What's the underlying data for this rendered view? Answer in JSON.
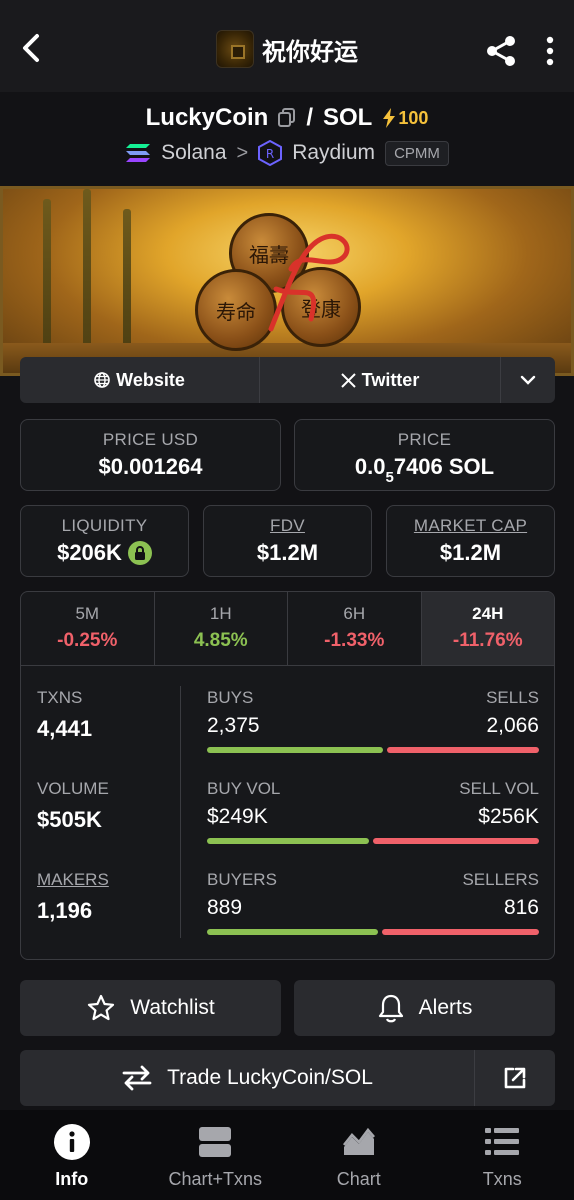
{
  "header": {
    "title": "祝你好运"
  },
  "pair": {
    "base": "LuckyCoin",
    "slash": "/",
    "quote": "SOL",
    "boost": "100",
    "chain": "Solana",
    "chevron": ">",
    "dex": "Raydium",
    "pool_type": "CPMM"
  },
  "links": {
    "website": "Website",
    "twitter": "Twitter"
  },
  "prices": {
    "price_usd_label": "PRICE USD",
    "price_usd": "$0.001264",
    "price_label": "PRICE",
    "price_prefix": "0.0",
    "price_zeros": "5",
    "price_suffix": "7406 SOL"
  },
  "caps": {
    "liquidity_label": "LIQUIDITY",
    "liquidity": "$206K",
    "fdv_label": "FDV",
    "fdv": "$1.2M",
    "mcap_label": "MARKET CAP",
    "mcap": "$1.2M"
  },
  "tabs": [
    {
      "label": "5M",
      "value": "-0.25%"
    },
    {
      "label": "1H",
      "value": "4.85%"
    },
    {
      "label": "6H",
      "value": "-1.33%"
    },
    {
      "label": "24H",
      "value": "-11.76%"
    }
  ],
  "metrics": {
    "txns_label": "TXNS",
    "txns": "4,441",
    "volume_label": "VOLUME",
    "volume": "$505K",
    "makers_label": "MAKERS",
    "makers": "1,196"
  },
  "breakdown": {
    "buys_label": "BUYS",
    "buys": "2,375",
    "sells_label": "SELLS",
    "sells": "2,066",
    "buy_ratio": 0.535,
    "buy_vol_label": "BUY VOL",
    "buy_vol": "$249K",
    "sell_vol_label": "SELL VOL",
    "sell_vol": "$256K",
    "buy_vol_ratio": 0.493,
    "buyers_label": "BUYERS",
    "buyers": "889",
    "sellers_label": "SELLERS",
    "sellers": "816",
    "buyers_ratio": 0.521
  },
  "actions": {
    "watchlist": "Watchlist",
    "alerts": "Alerts",
    "trade": "Trade LuckyCoin/SOL"
  },
  "nav": [
    {
      "label": "Info"
    },
    {
      "label": "Chart+Txns"
    },
    {
      "label": "Chart"
    },
    {
      "label": "Txns"
    }
  ],
  "colors": {
    "positive": "#8cc152",
    "negative": "#f0616a",
    "boost": "#f5c13b"
  },
  "banner_text": {
    "coin1": "福壽",
    "coin2": "寿命",
    "coin3": "登康"
  }
}
